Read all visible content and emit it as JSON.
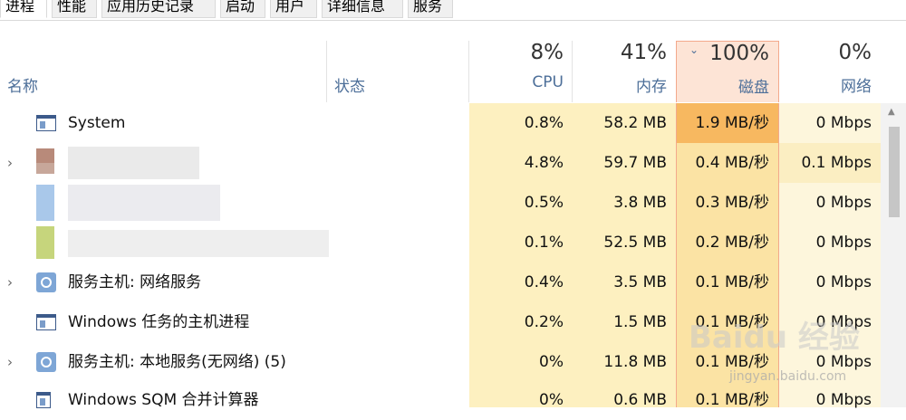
{
  "tabs": [
    "进程",
    "性能",
    "应用历史记录",
    "启动",
    "用户",
    "详细信息",
    "服务"
  ],
  "header": {
    "name_label": "名称",
    "status_label": "状态",
    "cpu": {
      "pct": "8%",
      "label": "CPU"
    },
    "mem": {
      "pct": "41%",
      "label": "内存"
    },
    "disk": {
      "pct": "100%",
      "label": "磁盘"
    },
    "net": {
      "pct": "0%",
      "label": "网络"
    }
  },
  "rows": [
    {
      "name": "System",
      "cpu": "0.8%",
      "mem": "58.2 MB",
      "disk": "1.9 MB/秒",
      "net": "0 Mbps"
    },
    {
      "name": "",
      "cpu": "4.8%",
      "mem": "59.7 MB",
      "disk": "0.4 MB/秒",
      "net": "0.1 Mbps"
    },
    {
      "name": "",
      "cpu": "0.5%",
      "mem": "3.8 MB",
      "disk": "0.3 MB/秒",
      "net": "0 Mbps"
    },
    {
      "name": "",
      "cpu": "0.1%",
      "mem": "52.5 MB",
      "disk": "0.2 MB/秒",
      "net": "0 Mbps"
    },
    {
      "name": "服务主机: 网络服务",
      "cpu": "0.4%",
      "mem": "3.5 MB",
      "disk": "0.1 MB/秒",
      "net": "0 Mbps"
    },
    {
      "name": "Windows 任务的主机进程",
      "cpu": "0.2%",
      "mem": "1.5 MB",
      "disk": "0.1 MB/秒",
      "net": "0 Mbps"
    },
    {
      "name": "服务主机: 本地服务(无网络) (5)",
      "cpu": "0%",
      "mem": "11.8 MB",
      "disk": "0.1 MB/秒",
      "net": "0 Mbps"
    },
    {
      "name": "Windows SQM 合并计算器",
      "cpu": "0%",
      "mem": "0.6 MB",
      "disk": "0.1 MB/秒",
      "net": "0 Mbps"
    }
  ],
  "watermark": {
    "brand": "Baidu 经验",
    "url": "jingyan.baidu.com"
  },
  "colors": {
    "cpu_col": "#fdf0c0",
    "mem_col": "#fdf0c0",
    "disk_col": "#fbe3a4",
    "disk_hot": "#f7b860",
    "net_col": "#fdf6dc"
  }
}
